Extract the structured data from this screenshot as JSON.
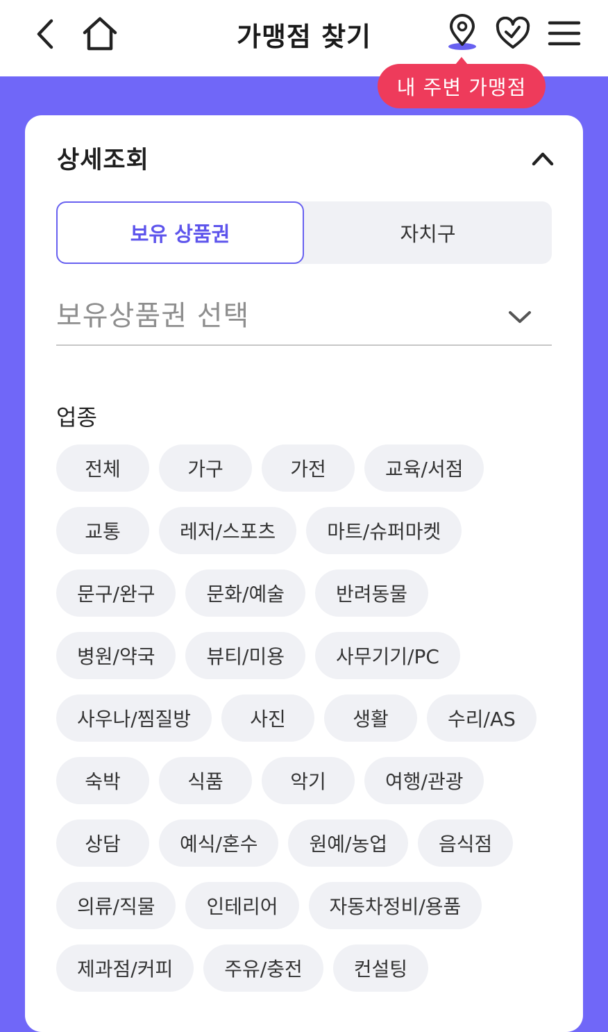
{
  "header": {
    "title": "가맹점 찾기",
    "icons": {
      "back": "chevron-left-icon",
      "home": "home-icon",
      "map": "map-pin-icon",
      "favorite": "heart-check-icon",
      "menu": "hamburger-menu-icon"
    },
    "tooltip": "내 주변 가맹점"
  },
  "colors": {
    "accent": "#6760f0",
    "tooltip": "#ee3b5b",
    "background": "#7067f8"
  },
  "detail": {
    "title": "상세조회",
    "collapse_icon": "chevron-up-icon",
    "tabs": [
      {
        "label": "보유 상품권",
        "selected": true
      },
      {
        "label": "자치구",
        "selected": false
      }
    ],
    "select": {
      "value": "보유상품권 선택",
      "icon": "chevron-down-icon"
    },
    "category_label": "업종",
    "categories": [
      "전체",
      "가구",
      "가전",
      "교육/서점",
      "교통",
      "레저/스포츠",
      "마트/슈퍼마켓",
      "문구/완구",
      "문화/예술",
      "반려동물",
      "병원/약국",
      "뷰티/미용",
      "사무기기/PC",
      "사우나/찜질방",
      "사진",
      "생활",
      "수리/AS",
      "숙박",
      "식품",
      "악기",
      "여행/관광",
      "상담",
      "예식/혼수",
      "원예/농업",
      "음식점",
      "의류/직물",
      "인테리어",
      "자동차정비/용품",
      "제과점/커피",
      "주유/충전",
      "컨설팅"
    ]
  }
}
